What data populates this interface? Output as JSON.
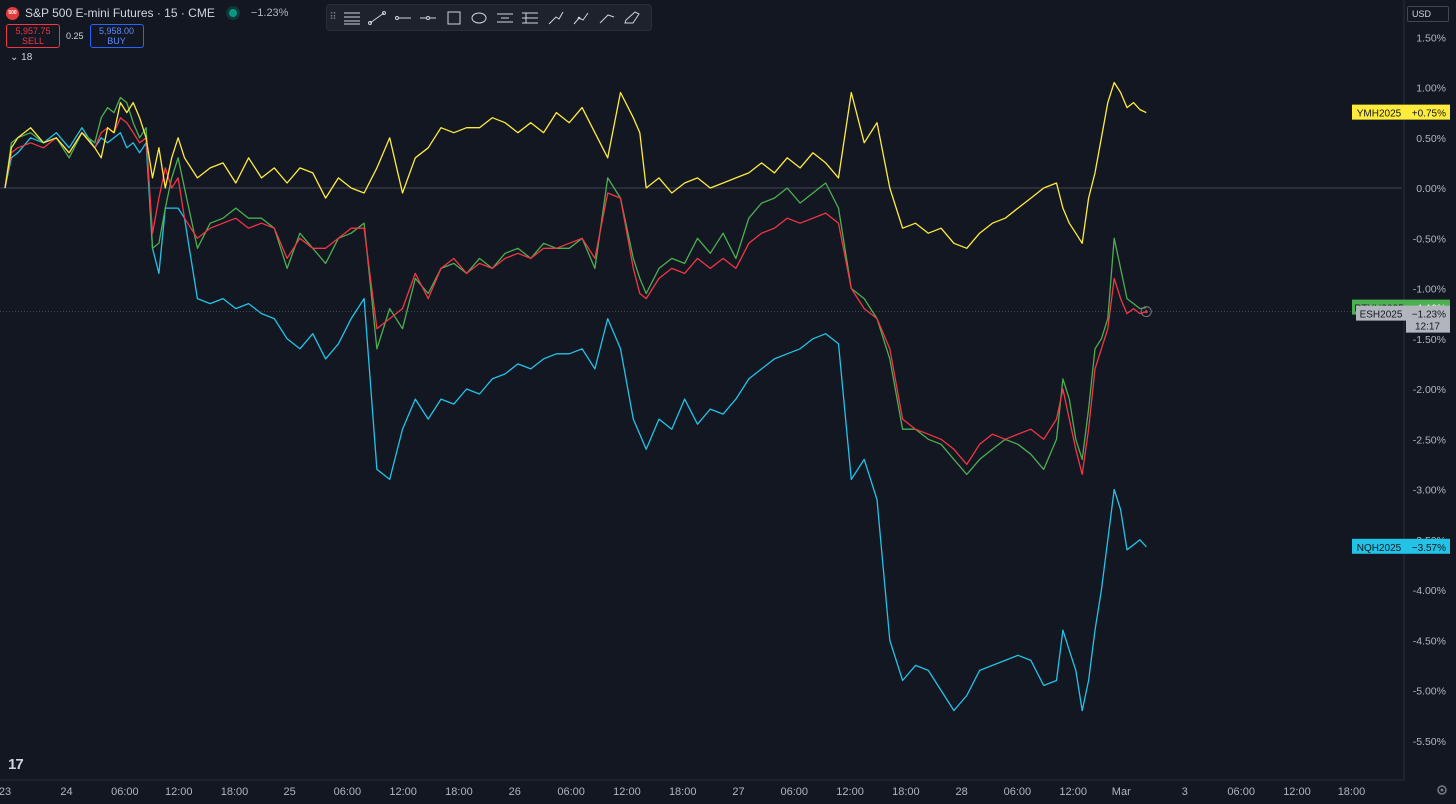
{
  "header": {
    "symbol_badge": "500",
    "title": "S&P 500 E-mini Futures · 15 · CME",
    "change": "−1.23%",
    "sell_price": "5,957.75",
    "sell_label": "SELL",
    "spread": "0.25",
    "buy_price": "5,958.00",
    "buy_label": "BUY",
    "indicator_count": "18"
  },
  "currency": "USD",
  "logo_text": "17",
  "icons": [
    "drag-grip-icon",
    "horizontal-lines-icon",
    "trend-line-icon",
    "horizontal-ray-icon",
    "horizontal-line-icon",
    "rectangle-icon",
    "ellipse-icon",
    "parallel-channel-icon",
    "pitchfork-icon",
    "brush-icon",
    "path-icon",
    "polyline-icon",
    "eraser-icon",
    "gear-icon",
    "chevron-down-icon"
  ],
  "colors": {
    "background": "#131722",
    "grid": "#2a2e39",
    "ymh": "#ffeb3b",
    "rtyh": "#4caf50",
    "esh": "#f23645",
    "nqh": "#22c3e6",
    "esh_label": "#b2b5be"
  },
  "chart_data": {
    "type": "line",
    "ylim": [
      -5.75,
      1.75
    ],
    "ylabel": "",
    "xlabel": "",
    "y_ticks": [
      "1.50%",
      "1.00%",
      "0.50%",
      "0.00%",
      "-0.50%",
      "-1.00%",
      "-1.50%",
      "-2.00%",
      "-2.50%",
      "-3.00%",
      "-3.50%",
      "-4.00%",
      "-4.50%",
      "-5.00%",
      "-5.50%"
    ],
    "x_ticks": [
      {
        "label": "23",
        "t": 0
      },
      {
        "label": "24",
        "t": 9.6
      },
      {
        "label": "06:00",
        "t": 18.7
      },
      {
        "label": "12:00",
        "t": 27.1
      },
      {
        "label": "18:00",
        "t": 35.8
      },
      {
        "label": "25",
        "t": 44.4
      },
      {
        "label": "06:00",
        "t": 53.4
      },
      {
        "label": "12:00",
        "t": 62.1
      },
      {
        "label": "18:00",
        "t": 70.8
      },
      {
        "label": "26",
        "t": 79.5
      },
      {
        "label": "06:00",
        "t": 88.3
      },
      {
        "label": "12:00",
        "t": 97.0
      },
      {
        "label": "18:00",
        "t": 105.7
      },
      {
        "label": "27",
        "t": 114.4
      },
      {
        "label": "06:00",
        "t": 123.1
      },
      {
        "label": "12:00",
        "t": 131.8
      },
      {
        "label": "18:00",
        "t": 140.5
      },
      {
        "label": "28",
        "t": 149.2
      },
      {
        "label": "06:00",
        "t": 157.9
      },
      {
        "label": "12:00",
        "t": 166.6
      },
      {
        "label": "Mar",
        "t": 174.1
      },
      {
        "label": "3",
        "t": 184.0
      },
      {
        "label": "06:00",
        "t": 192.8
      },
      {
        "label": "12:00",
        "t": 201.5
      },
      {
        "label": "18:00",
        "t": 210.0
      }
    ],
    "xlim": [
      0,
      212
    ],
    "zero_line": 0,
    "series": [
      {
        "name": "YMH2025",
        "last_label": "+0.75%",
        "x": [
          0,
          1,
          2,
          4,
          6,
          8,
          10,
          12,
          14,
          15,
          16,
          17,
          18,
          19,
          20,
          21,
          22,
          23,
          24,
          25,
          26,
          27,
          28,
          30,
          32,
          34,
          36,
          38,
          40,
          42,
          44,
          46,
          48,
          50,
          52,
          54,
          56,
          58,
          60,
          62,
          64,
          66,
          68,
          70,
          72,
          74,
          76,
          78,
          80,
          82,
          84,
          86,
          88,
          90,
          92,
          94,
          96,
          98,
          99,
          100,
          102,
          104,
          106,
          108,
          110,
          112,
          114,
          116,
          118,
          120,
          122,
          124,
          126,
          128,
          130,
          132,
          134,
          136,
          138,
          140,
          142,
          144,
          146,
          148,
          150,
          152,
          154,
          156,
          158,
          160,
          162,
          164,
          165,
          166,
          167,
          168,
          169,
          170,
          171,
          172,
          173,
          174,
          175,
          176,
          177,
          178
        ],
        "y": [
          0.0,
          0.4,
          0.5,
          0.6,
          0.45,
          0.5,
          0.35,
          0.55,
          0.4,
          0.3,
          0.6,
          0.55,
          0.85,
          0.75,
          0.85,
          0.7,
          0.5,
          0.1,
          0.4,
          0.0,
          0.3,
          0.5,
          0.3,
          0.1,
          0.2,
          0.25,
          0.05,
          0.3,
          0.1,
          0.2,
          0.05,
          0.2,
          0.15,
          -0.1,
          0.1,
          0.0,
          -0.05,
          0.2,
          0.5,
          -0.05,
          0.3,
          0.4,
          0.6,
          0.55,
          0.6,
          0.6,
          0.7,
          0.65,
          0.55,
          0.65,
          0.55,
          0.75,
          0.65,
          0.8,
          0.55,
          0.3,
          0.95,
          0.7,
          0.55,
          0.0,
          0.1,
          -0.05,
          0.05,
          0.1,
          0.0,
          0.05,
          0.1,
          0.15,
          0.25,
          0.15,
          0.3,
          0.2,
          0.35,
          0.25,
          0.1,
          0.95,
          0.45,
          0.65,
          0.0,
          -0.4,
          -0.35,
          -0.45,
          -0.4,
          -0.55,
          -0.6,
          -0.45,
          -0.35,
          -0.3,
          -0.2,
          -0.1,
          0.0,
          0.05,
          -0.2,
          -0.35,
          -0.45,
          -0.55,
          -0.1,
          0.15,
          0.5,
          0.85,
          1.05,
          0.95,
          0.8,
          0.85,
          0.78,
          0.75
        ]
      },
      {
        "name": "RTYH2025",
        "last_label": "−1.19%",
        "x": [
          0,
          1,
          2,
          4,
          6,
          8,
          10,
          12,
          14,
          15,
          16,
          17,
          18,
          19,
          20,
          21,
          22,
          23,
          24,
          25,
          26,
          27,
          28,
          30,
          32,
          34,
          36,
          38,
          40,
          42,
          44,
          46,
          48,
          50,
          52,
          54,
          56,
          58,
          60,
          62,
          64,
          66,
          68,
          70,
          72,
          74,
          76,
          78,
          80,
          82,
          84,
          86,
          88,
          90,
          92,
          94,
          96,
          98,
          99,
          100,
          102,
          104,
          106,
          108,
          110,
          112,
          114,
          116,
          118,
          120,
          122,
          124,
          126,
          128,
          130,
          132,
          134,
          136,
          138,
          140,
          142,
          144,
          146,
          148,
          150,
          152,
          154,
          156,
          158,
          160,
          162,
          164,
          165,
          166,
          167,
          168,
          169,
          170,
          171,
          172,
          173,
          174,
          175,
          176,
          177,
          178
        ],
        "y": [
          0.0,
          0.45,
          0.5,
          0.55,
          0.45,
          0.5,
          0.3,
          0.55,
          0.45,
          0.7,
          0.8,
          0.75,
          0.9,
          0.85,
          0.65,
          0.5,
          0.6,
          -0.6,
          -0.55,
          -0.2,
          0.1,
          0.3,
          0.0,
          -0.6,
          -0.35,
          -0.3,
          -0.2,
          -0.3,
          -0.3,
          -0.4,
          -0.8,
          -0.45,
          -0.6,
          -0.75,
          -0.5,
          -0.45,
          -0.35,
          -1.6,
          -1.2,
          -1.4,
          -0.9,
          -1.05,
          -0.8,
          -0.75,
          -0.85,
          -0.7,
          -0.8,
          -0.65,
          -0.6,
          -0.7,
          -0.55,
          -0.6,
          -0.6,
          -0.5,
          -0.8,
          0.1,
          -0.1,
          -0.7,
          -0.9,
          -1.05,
          -0.8,
          -0.7,
          -0.75,
          -0.5,
          -0.65,
          -0.45,
          -0.7,
          -0.3,
          -0.15,
          -0.1,
          0.0,
          -0.15,
          -0.05,
          0.05,
          -0.2,
          -1.0,
          -1.1,
          -1.3,
          -1.7,
          -2.4,
          -2.4,
          -2.5,
          -2.55,
          -2.7,
          -2.85,
          -2.7,
          -2.6,
          -2.5,
          -2.55,
          -2.65,
          -2.8,
          -2.5,
          -1.9,
          -2.1,
          -2.5,
          -2.7,
          -2.2,
          -1.6,
          -1.5,
          -1.3,
          -0.5,
          -0.8,
          -1.1,
          -1.15,
          -1.2,
          -1.19
        ]
      },
      {
        "name": "ESH2025",
        "last_label": "−1.23%",
        "time_label": "12:17",
        "x": [
          0,
          1,
          2,
          4,
          6,
          8,
          10,
          12,
          14,
          15,
          16,
          17,
          18,
          19,
          20,
          21,
          22,
          23,
          24,
          25,
          26,
          27,
          28,
          30,
          32,
          34,
          36,
          38,
          40,
          42,
          44,
          46,
          48,
          50,
          52,
          54,
          56,
          58,
          60,
          62,
          64,
          66,
          68,
          70,
          72,
          74,
          76,
          78,
          80,
          82,
          84,
          86,
          88,
          90,
          92,
          94,
          96,
          98,
          99,
          100,
          102,
          104,
          106,
          108,
          110,
          112,
          114,
          116,
          118,
          120,
          122,
          124,
          126,
          128,
          130,
          132,
          134,
          136,
          138,
          140,
          142,
          144,
          146,
          148,
          150,
          152,
          154,
          156,
          158,
          160,
          162,
          164,
          165,
          166,
          167,
          168,
          169,
          170,
          171,
          172,
          173,
          174,
          175,
          176,
          177,
          178
        ],
        "y": [
          0.0,
          0.35,
          0.4,
          0.45,
          0.4,
          0.5,
          0.35,
          0.55,
          0.4,
          0.55,
          0.6,
          0.55,
          0.7,
          0.65,
          0.55,
          0.45,
          0.5,
          -0.45,
          -0.1,
          0.2,
          0.0,
          0.1,
          -0.3,
          -0.5,
          -0.4,
          -0.35,
          -0.3,
          -0.4,
          -0.35,
          -0.4,
          -0.7,
          -0.5,
          -0.6,
          -0.6,
          -0.5,
          -0.4,
          -0.4,
          -1.4,
          -1.3,
          -1.2,
          -0.85,
          -1.1,
          -0.8,
          -0.7,
          -0.85,
          -0.75,
          -0.8,
          -0.7,
          -0.65,
          -0.7,
          -0.6,
          -0.6,
          -0.55,
          -0.5,
          -0.7,
          -0.05,
          -0.1,
          -0.8,
          -1.05,
          -1.1,
          -0.9,
          -0.8,
          -0.85,
          -0.7,
          -0.8,
          -0.7,
          -0.8,
          -0.55,
          -0.45,
          -0.4,
          -0.3,
          -0.35,
          -0.3,
          -0.25,
          -0.35,
          -1.0,
          -1.2,
          -1.3,
          -1.6,
          -2.3,
          -2.4,
          -2.45,
          -2.5,
          -2.6,
          -2.75,
          -2.55,
          -2.45,
          -2.5,
          -2.45,
          -2.4,
          -2.5,
          -2.3,
          -2.0,
          -2.3,
          -2.6,
          -2.85,
          -2.4,
          -1.8,
          -1.6,
          -1.4,
          -0.9,
          -1.1,
          -1.25,
          -1.2,
          -1.25,
          -1.23
        ]
      },
      {
        "name": "NQH2025",
        "last_label": "−3.57%",
        "x": [
          0,
          1,
          2,
          4,
          6,
          8,
          10,
          12,
          14,
          15,
          16,
          17,
          18,
          19,
          20,
          21,
          22,
          23,
          24,
          25,
          26,
          27,
          28,
          30,
          32,
          34,
          36,
          38,
          40,
          42,
          44,
          46,
          48,
          50,
          52,
          54,
          56,
          58,
          60,
          62,
          64,
          66,
          68,
          70,
          72,
          74,
          76,
          78,
          80,
          82,
          84,
          86,
          88,
          90,
          92,
          94,
          96,
          98,
          99,
          100,
          102,
          104,
          106,
          108,
          110,
          112,
          114,
          116,
          118,
          120,
          122,
          124,
          126,
          128,
          130,
          132,
          134,
          136,
          138,
          140,
          142,
          144,
          146,
          148,
          150,
          152,
          154,
          156,
          158,
          160,
          162,
          164,
          165,
          166,
          167,
          168,
          169,
          170,
          171,
          172,
          173,
          174,
          175,
          176,
          177,
          178
        ],
        "y": [
          0.0,
          0.3,
          0.35,
          0.5,
          0.45,
          0.55,
          0.4,
          0.6,
          0.4,
          0.5,
          0.45,
          0.5,
          0.55,
          0.4,
          0.45,
          0.35,
          0.45,
          -0.6,
          -0.85,
          -0.2,
          -0.2,
          -0.2,
          -0.3,
          -1.1,
          -1.15,
          -1.1,
          -1.2,
          -1.15,
          -1.25,
          -1.3,
          -1.5,
          -1.6,
          -1.45,
          -1.7,
          -1.55,
          -1.3,
          -1.1,
          -2.8,
          -2.9,
          -2.4,
          -2.1,
          -2.3,
          -2.1,
          -2.15,
          -2.0,
          -2.05,
          -1.9,
          -1.85,
          -1.75,
          -1.8,
          -1.7,
          -1.65,
          -1.65,
          -1.6,
          -1.8,
          -1.3,
          -1.6,
          -2.3,
          -2.45,
          -2.6,
          -2.3,
          -2.4,
          -2.1,
          -2.35,
          -2.2,
          -2.25,
          -2.1,
          -1.9,
          -1.8,
          -1.7,
          -1.65,
          -1.6,
          -1.5,
          -1.45,
          -1.55,
          -2.9,
          -2.7,
          -3.1,
          -4.5,
          -4.9,
          -4.75,
          -4.8,
          -5.0,
          -5.2,
          -5.05,
          -4.8,
          -4.75,
          -4.7,
          -4.65,
          -4.7,
          -4.95,
          -4.9,
          -4.4,
          -4.6,
          -4.8,
          -5.2,
          -4.9,
          -4.4,
          -4.0,
          -3.5,
          -3.0,
          -3.2,
          -3.6,
          -3.55,
          -3.5,
          -3.57
        ]
      }
    ]
  }
}
